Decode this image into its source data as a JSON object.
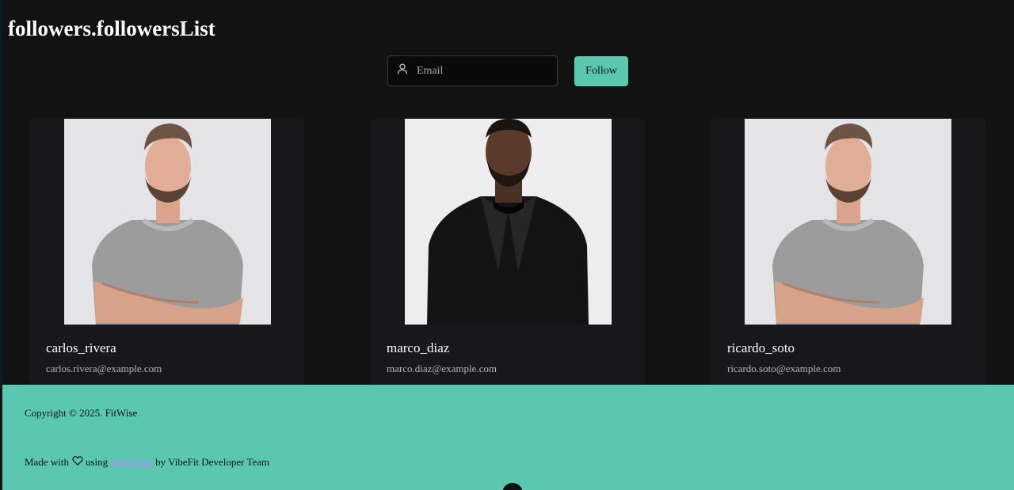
{
  "page": {
    "title": "followers.followersList"
  },
  "follow_form": {
    "email_placeholder": "Email",
    "email_value": "",
    "follow_label": "Follow"
  },
  "followers": [
    {
      "username": "carlos_rivera",
      "email": "carlos.rivera@example.com",
      "photo": "portrait-man-grey-tshirt"
    },
    {
      "username": "marco_diaz",
      "email": "marco.diaz@example.com",
      "photo": "portrait-man-black-tuxedo"
    },
    {
      "username": "ricardo_soto",
      "email": "ricardo.soto@example.com",
      "photo": "portrait-man-grey-tshirt"
    }
  ],
  "footer": {
    "copyright": "Copyright © 2025. FitWise",
    "made_with_prefix": "Made with",
    "made_with_using": "using",
    "library_link": "PrimeVue",
    "made_with_suffix": "by VibeFit Developer Team"
  },
  "icons": {
    "email_field": "user-icon",
    "made_with": "heart-icon"
  },
  "colors": {
    "accent": "#5ac8b0",
    "background": "#121212",
    "card": "#18181b",
    "link": "#c084fc"
  }
}
